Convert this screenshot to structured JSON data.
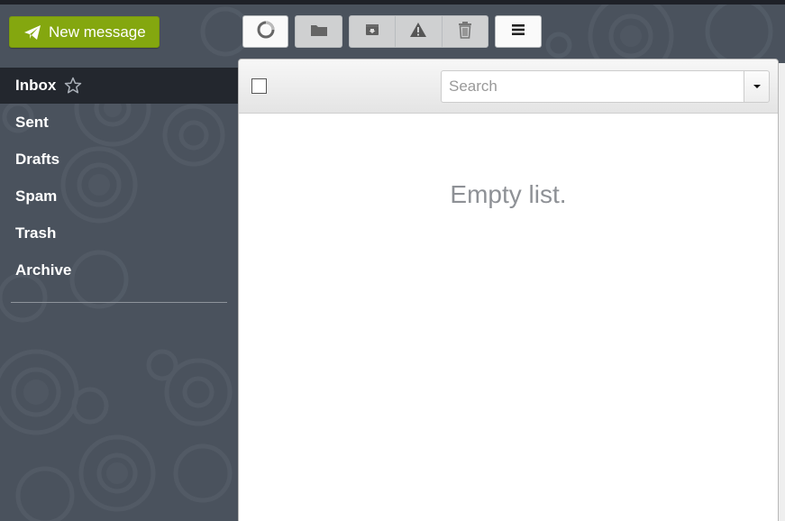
{
  "app": {
    "compose_button": {
      "label": "New message",
      "icon": "paper-plane-icon",
      "color": "#84a70f"
    }
  },
  "sidebar": {
    "items": [
      {
        "label": "Inbox",
        "active": true,
        "icon": "star-outline-icon"
      },
      {
        "label": "Sent"
      },
      {
        "label": "Drafts"
      },
      {
        "label": "Spam"
      },
      {
        "label": "Trash"
      },
      {
        "label": "Archive"
      }
    ]
  },
  "toolbar": {
    "buttons": [
      {
        "name": "refresh",
        "icon": "refresh-circle-icon"
      },
      {
        "name": "move-to-folder",
        "icon": "folder-icon"
      },
      {
        "name": "archive",
        "icon": "archive-box-icon"
      },
      {
        "name": "spam",
        "icon": "warning-triangle-icon"
      },
      {
        "name": "delete",
        "icon": "trash-icon"
      },
      {
        "name": "more",
        "icon": "menu-lines-icon"
      }
    ]
  },
  "list": {
    "search": {
      "placeholder": "Search",
      "value": ""
    },
    "select_all_checked": false,
    "empty_message": "Empty list."
  }
}
